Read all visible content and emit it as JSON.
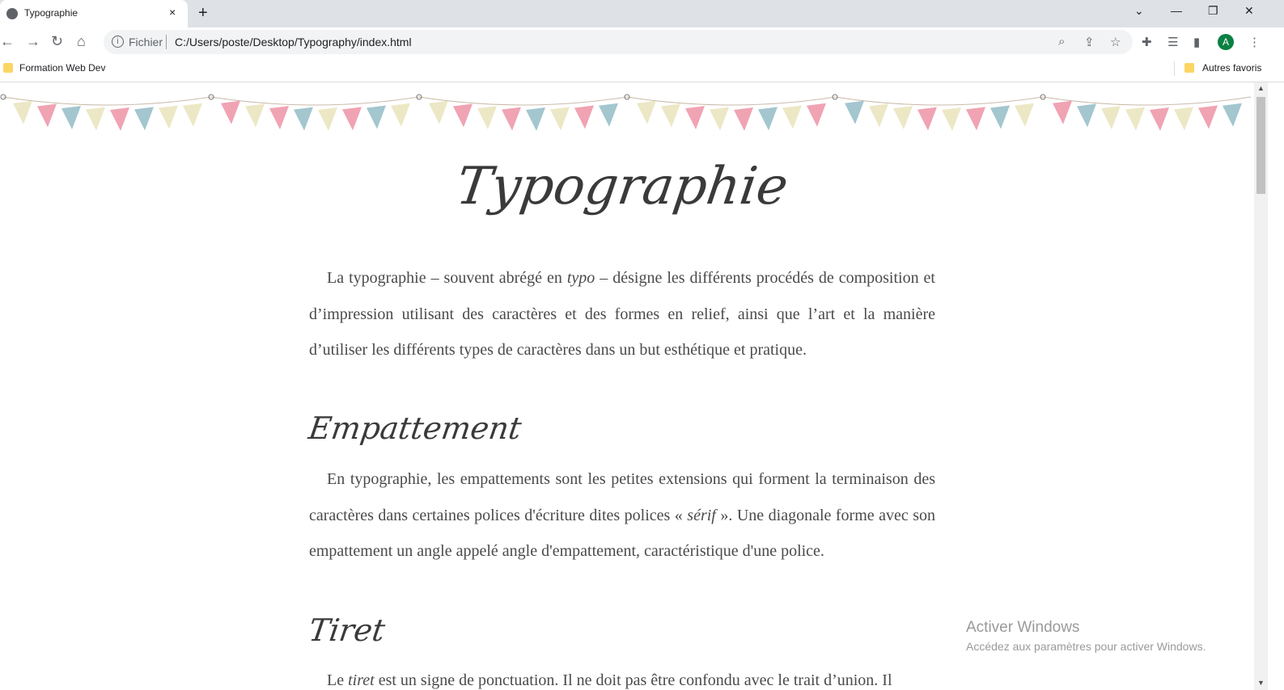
{
  "browser": {
    "tab_title": "Typographie",
    "tab_close": "×",
    "new_tab": "+",
    "scheme_label": "Fichier",
    "url": "C:/Users/poste/Desktop/Typography/index.html",
    "profile_initial": "A",
    "bookmarks": [
      {
        "label": "Formation Web Dev"
      },
      {
        "label": "Autres favoris"
      }
    ],
    "window_controls": {
      "minimize": "—",
      "restore": "❐",
      "close": "✕",
      "tab_search": "⌄"
    }
  },
  "page": {
    "title": "Typographie",
    "intro": {
      "before": "La typographie – souvent abrégé en ",
      "em": "typo",
      "after": " – désigne les différents procédés de composition et d’impression utilisant des caractères et des formes en relief, ainsi que l’art et la manière d’utiliser les différents types de caractères dans un but esthétique et pratique."
    },
    "sections": [
      {
        "heading": "Empattement",
        "before": "En typographie, les empattements sont les petites extensions qui forment la terminaison des caractères dans certaines polices d'écriture dites polices « ",
        "em": "sérif",
        "after": " ». Une diagonale forme avec son empattement un angle appelé angle d'empattement, caractéristique d'une police."
      },
      {
        "heading": "Tiret",
        "before": "Le ",
        "em": "tiret",
        "after": " est un signe de ponctuation. Il ne doit pas être confondu avec le trait d’union. Il"
      }
    ]
  },
  "watermark": {
    "line1": "Activer Windows",
    "line2": "Accédez aux paramètres pour activer Windows."
  },
  "colors": {
    "flag_pink": "#f0a3b3",
    "flag_blue": "#a3c6cf",
    "flag_cream": "#ece8c6",
    "text": "#4a4a4a"
  }
}
